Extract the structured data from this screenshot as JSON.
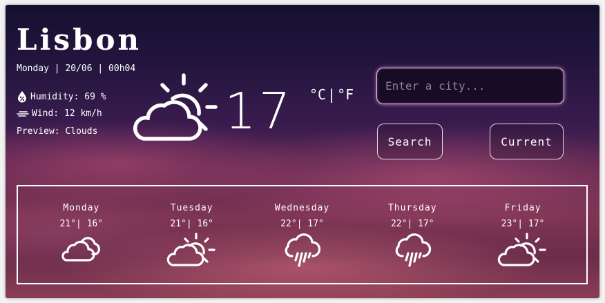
{
  "app": {
    "city": "Lisbon",
    "datetime": "Monday | 20/06 | 00h04"
  },
  "current": {
    "humidity": "Humidity: 69 %",
    "wind": "Wind: 12 km/h",
    "preview": "Preview: Clouds",
    "temperature": "17",
    "icon": "sun-behind-cloud-icon"
  },
  "units": {
    "celsius": "°C",
    "separator": "|",
    "fahrenheit": "°F"
  },
  "search": {
    "placeholder": "Enter a city...",
    "value": "",
    "search_label": "Search",
    "current_label": "Current"
  },
  "forecast": [
    {
      "day": "Monday",
      "temps": "21°| 16°",
      "icon": "clouds-icon"
    },
    {
      "day": "Tuesday",
      "temps": "21°| 16°",
      "icon": "sun-behind-cloud-icon"
    },
    {
      "day": "Wednesday",
      "temps": "22°| 17°",
      "icon": "rain-cloud-icon"
    },
    {
      "day": "Thursday",
      "temps": "22°| 17°",
      "icon": "rain-cloud-icon"
    },
    {
      "day": "Friday",
      "temps": "23°| 17°",
      "icon": "sun-behind-cloud-icon"
    }
  ],
  "colors": {
    "text": "#ffffff",
    "input_glow": "#f0c0e4"
  }
}
